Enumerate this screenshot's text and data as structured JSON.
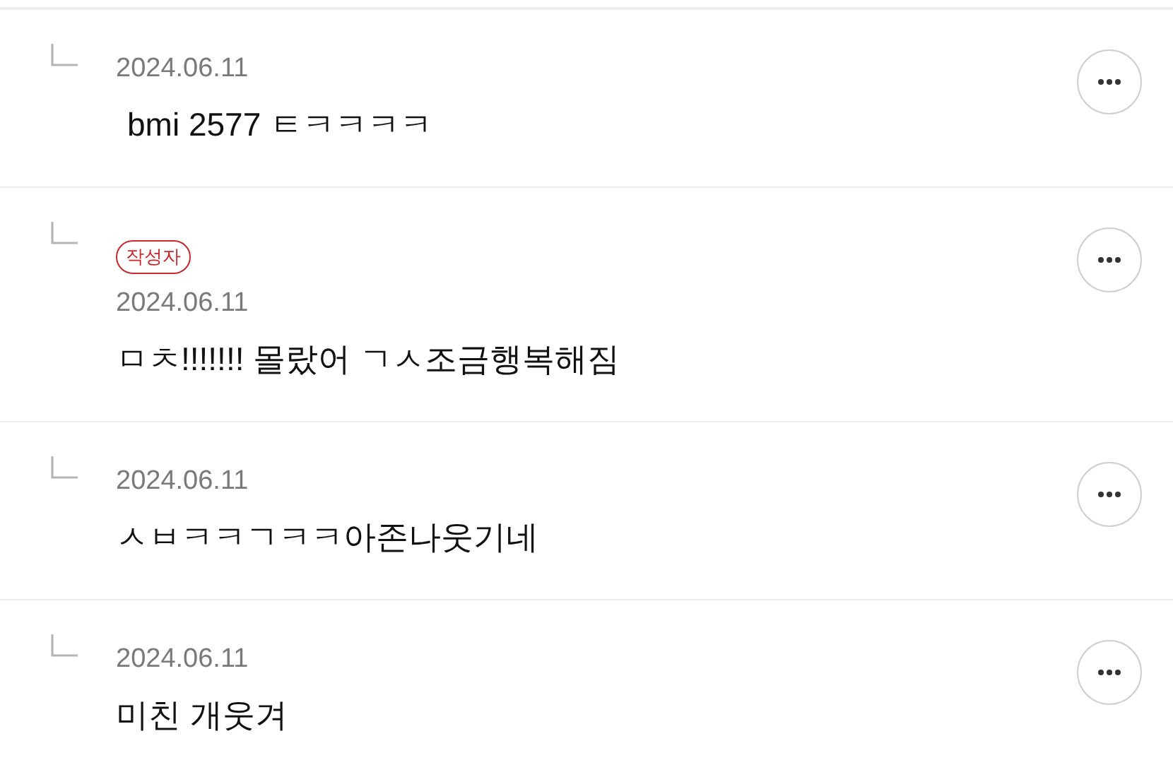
{
  "comments": [
    {
      "date": "2024.06.11",
      "text": "bmi 2577 ㅌㅋㅋㅋㅋ"
    },
    {
      "author_badge": "작성자",
      "date": "2024.06.11",
      "text": "ㅁㅊ!!!!!!! 몰랐어 ㄱㅅ조금행복해짐"
    },
    {
      "date": "2024.06.11",
      "text": "ㅅㅂㅋㅋㄱㅋㅋ아존나웃기네"
    },
    {
      "date": "2024.06.11",
      "text": "미친 개웃겨"
    }
  ]
}
